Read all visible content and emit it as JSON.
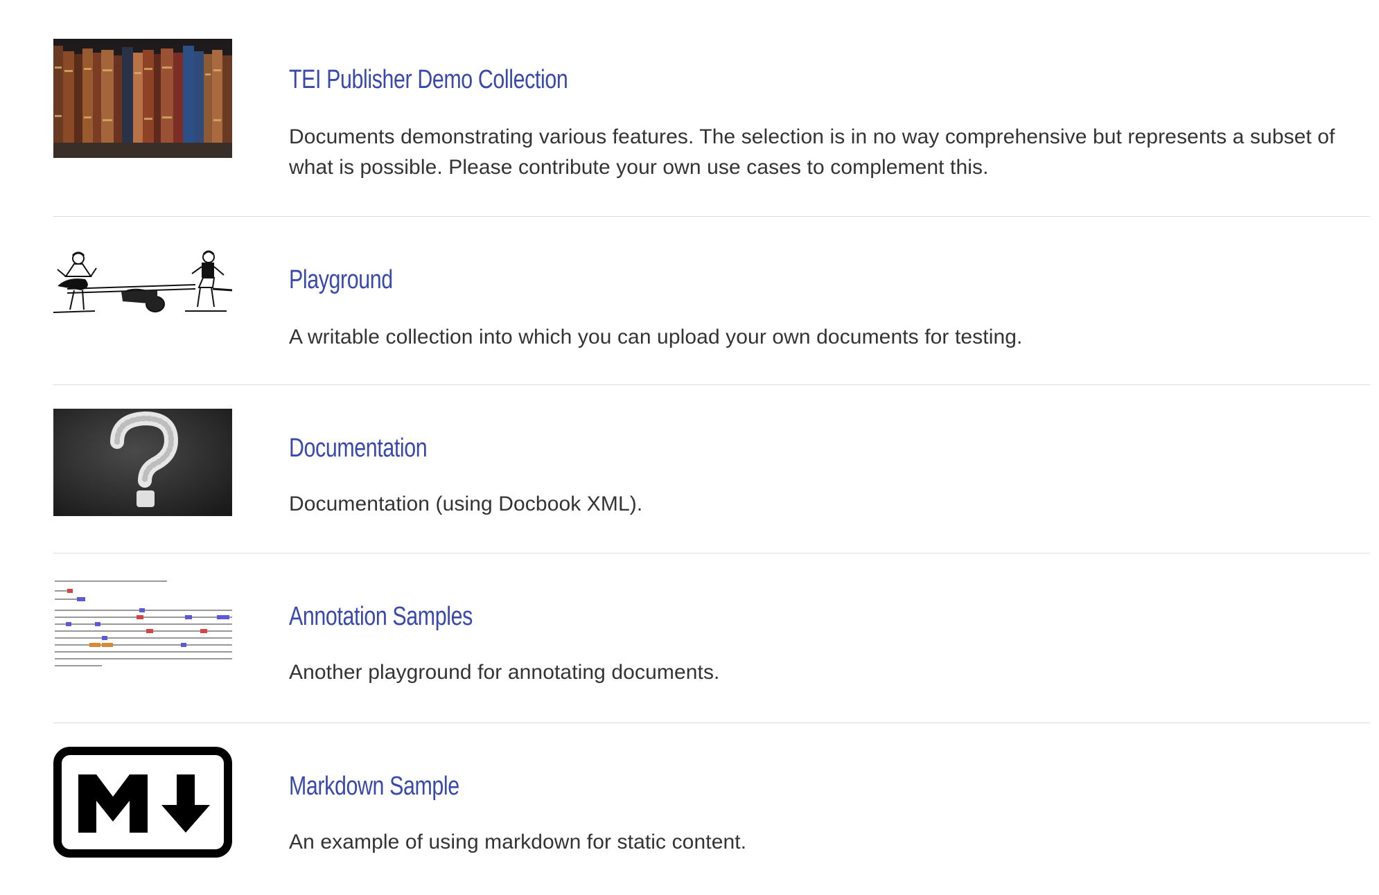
{
  "collections": [
    {
      "title": "TEI Publisher Demo Collection",
      "description": "Documents demonstrating various features. The selection is in no way comprehensive but represents a subset of what is possible. Please contribute your own use cases to complement this.",
      "thumbnail": "bookshelf-image"
    },
    {
      "title": "Playground",
      "description": "A writable collection into which you can upload your own documents for testing.",
      "thumbnail": "seesaw-illustration"
    },
    {
      "title": "Documentation",
      "description": "Documentation (using Docbook XML).",
      "thumbnail": "question-mark-chalkboard-image"
    },
    {
      "title": "Annotation Samples",
      "description": "Another playground for annotating documents.",
      "thumbnail": "annotated-letter-image"
    },
    {
      "title": "Markdown Sample",
      "description": "An example of using markdown for static content.",
      "thumbnail": "markdown-logo-icon"
    }
  ],
  "colors": {
    "link": "#3949ab",
    "text": "#333333",
    "divider": "#dcdcdc"
  }
}
